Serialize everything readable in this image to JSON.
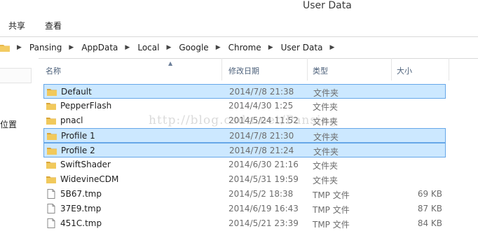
{
  "window": {
    "title": "User Data"
  },
  "ribbon": {
    "tabs": [
      "共享",
      "查看"
    ]
  },
  "address": {
    "crumbs": [
      "Pansing",
      "AppData",
      "Local",
      "Google",
      "Chrome",
      "User Data"
    ]
  },
  "nav": {
    "item_label": "位置"
  },
  "columns": {
    "name": "名称",
    "date": "修改日期",
    "type": "类型",
    "size": "大小"
  },
  "files": [
    {
      "name": "Default",
      "date": "2014/7/8 21:38",
      "type": "文件夹",
      "size": "",
      "icon": "folder-icon",
      "selected": true
    },
    {
      "name": "PepperFlash",
      "date": "2014/4/30 1:25",
      "type": "文件夹",
      "size": "",
      "icon": "folder-icon",
      "selected": false
    },
    {
      "name": "pnacl",
      "date": "2014/5/24 11:52",
      "type": "文件夹",
      "size": "",
      "icon": "folder-icon",
      "selected": false
    },
    {
      "name": "Profile 1",
      "date": "2014/7/8 21:30",
      "type": "文件夹",
      "size": "",
      "icon": "folder-icon",
      "selected": true
    },
    {
      "name": "Profile 2",
      "date": "2014/7/8 21:24",
      "type": "文件夹",
      "size": "",
      "icon": "folder-icon",
      "selected": true
    },
    {
      "name": "SwiftShader",
      "date": "2014/6/30 21:16",
      "type": "文件夹",
      "size": "",
      "icon": "folder-icon",
      "selected": false
    },
    {
      "name": "WidevineCDM",
      "date": "2014/5/31 19:59",
      "type": "文件夹",
      "size": "",
      "icon": "folder-icon",
      "selected": false
    },
    {
      "name": "5B67.tmp",
      "date": "2014/5/2 18:38",
      "type": "TMP 文件",
      "size": "69 KB",
      "icon": "file-icon",
      "selected": false
    },
    {
      "name": "37E9.tmp",
      "date": "2014/6/19 16:43",
      "type": "TMP 文件",
      "size": "87 KB",
      "icon": "file-icon",
      "selected": false
    },
    {
      "name": "451C.tmp",
      "date": "2014/5/21 23:39",
      "type": "TMP 文件",
      "size": "84 KB",
      "icon": "file-icon",
      "selected": false
    }
  ],
  "watermark": "http://blog.csdn.net/Pansing",
  "colors": {
    "selection_bg": "#cce8ff",
    "selection_border": "#66a7e8",
    "folder": "#e8b84a",
    "header_text": "#4c607a"
  }
}
